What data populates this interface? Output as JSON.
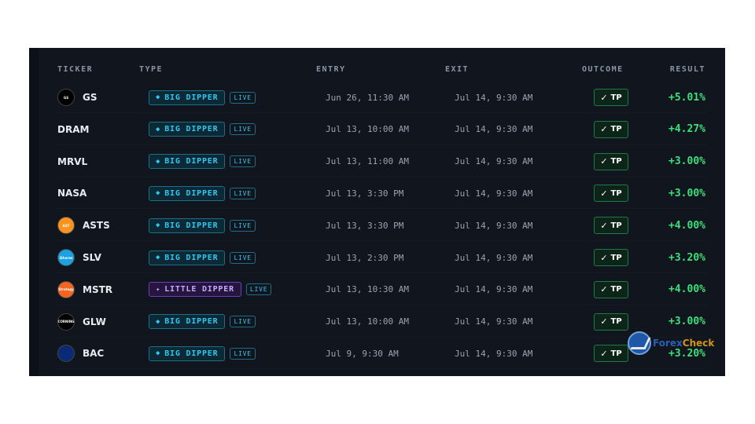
{
  "header": {
    "ticker": "TICKER",
    "type": "TYPE",
    "entry": "ENTRY",
    "exit": "EXIT",
    "outcome": "OUTCOME",
    "result": "RESULT"
  },
  "colors": {
    "background": "#11161e",
    "big_dipper": "#33c5f0",
    "little_dipper": "#c7a8ff",
    "positive": "#3ee07a",
    "tp_border": "#1f7a48"
  },
  "rows": [
    {
      "ticker": "GS",
      "logo": "gs-logo",
      "logo_text": "GS",
      "type": "BIG DIPPER",
      "type_kind": "big",
      "live": "LIVE",
      "entry": "Jun 26, 11:30 AM",
      "exit": "Jul 14, 9:30 AM",
      "outcome": "TP",
      "result": "+5.01%"
    },
    {
      "ticker": "DRAM",
      "logo": "",
      "logo_text": "",
      "type": "BIG DIPPER",
      "type_kind": "big",
      "live": "LIVE",
      "entry": "Jul 13, 10:00 AM",
      "exit": "Jul 14, 9:30 AM",
      "outcome": "TP",
      "result": "+4.27%"
    },
    {
      "ticker": "MRVL",
      "logo": "",
      "logo_text": "",
      "type": "BIG DIPPER",
      "type_kind": "big",
      "live": "LIVE",
      "entry": "Jul 13, 11:00 AM",
      "exit": "Jul 14, 9:30 AM",
      "outcome": "TP",
      "result": "+3.00%"
    },
    {
      "ticker": "NASA",
      "logo": "",
      "logo_text": "",
      "type": "BIG DIPPER",
      "type_kind": "big",
      "live": "LIVE",
      "entry": "Jul 13, 3:30 PM",
      "exit": "Jul 14, 9:30 AM",
      "outcome": "TP",
      "result": "+3.00%"
    },
    {
      "ticker": "ASTS",
      "logo": "asts-logo",
      "logo_text": "AST",
      "type": "BIG DIPPER",
      "type_kind": "big",
      "live": "LIVE",
      "entry": "Jul 13, 3:30 PM",
      "exit": "Jul 14, 9:30 AM",
      "outcome": "TP",
      "result": "+4.00%"
    },
    {
      "ticker": "SLV",
      "logo": "slv-logo",
      "logo_text": "iShares",
      "type": "BIG DIPPER",
      "type_kind": "big",
      "live": "LIVE",
      "entry": "Jul 13, 2:30 PM",
      "exit": "Jul 14, 9:30 AM",
      "outcome": "TP",
      "result": "+3.20%"
    },
    {
      "ticker": "MSTR",
      "logo": "mstr-logo",
      "logo_text": "Strategy",
      "type": "LITTLE DIPPER",
      "type_kind": "little",
      "live": "LIVE",
      "entry": "Jul 13, 10:30 AM",
      "exit": "Jul 14, 9:30 AM",
      "outcome": "TP",
      "result": "+4.00%"
    },
    {
      "ticker": "GLW",
      "logo": "glw-logo",
      "logo_text": "CORNING",
      "type": "BIG DIPPER",
      "type_kind": "big",
      "live": "LIVE",
      "entry": "Jul 13, 10:00 AM",
      "exit": "Jul 14, 9:30 AM",
      "outcome": "TP",
      "result": "+3.00%"
    },
    {
      "ticker": "BAC",
      "logo": "bac-logo",
      "logo_text": "",
      "type": "BIG DIPPER",
      "type_kind": "big",
      "live": "LIVE",
      "entry": "Jul 9, 9:30 AM",
      "exit": "Jul 14, 9:30 AM",
      "outcome": "TP",
      "result": "+3.20%"
    }
  ],
  "watermark": {
    "text_a": "Forex",
    "text_b": "Check"
  }
}
